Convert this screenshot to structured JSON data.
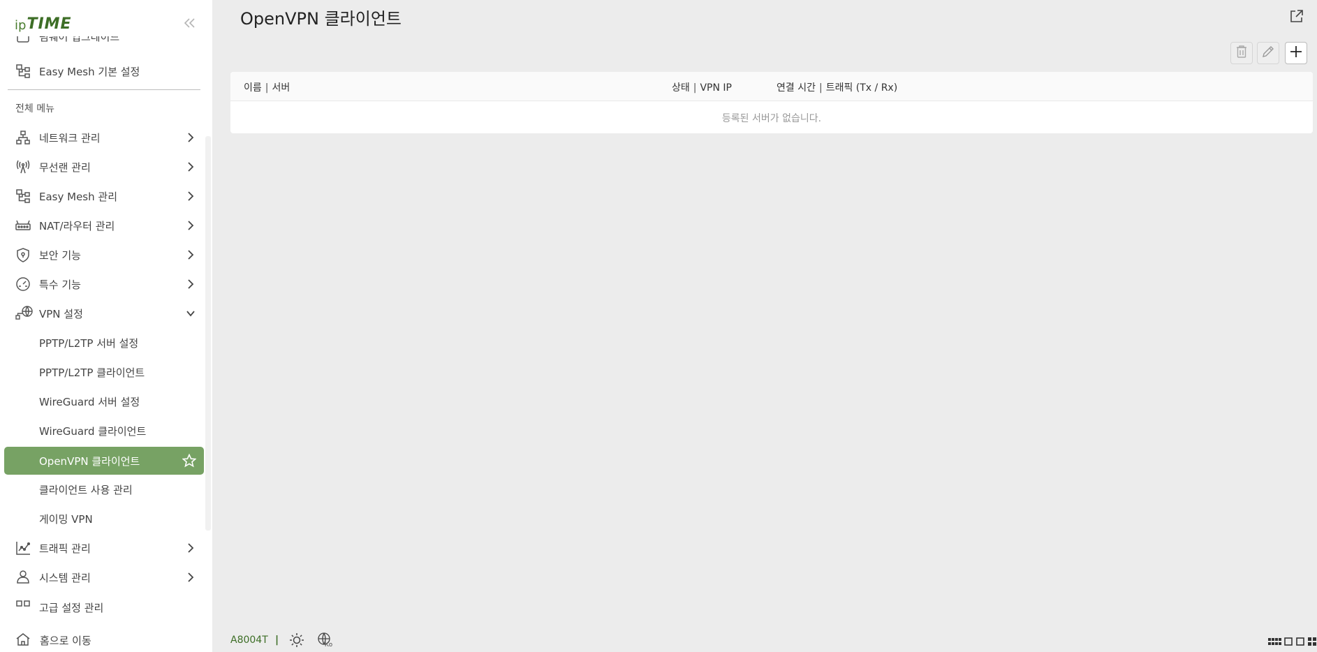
{
  "logo": {
    "ip": "ip",
    "time": "TIME"
  },
  "sidebar": {
    "partial_top_label": "펌웨어 업그레이드",
    "easymesh_basic": "Easy Mesh 기본 설정",
    "section_title": "전체 메뉴",
    "items": [
      {
        "label": "네트워크 관리",
        "icon": "network-icon"
      },
      {
        "label": "무선랜 관리",
        "icon": "wireless-icon"
      },
      {
        "label": "Easy Mesh 관리",
        "icon": "mesh-icon"
      },
      {
        "label": "NAT/라우터 관리",
        "icon": "router-icon"
      },
      {
        "label": "보안 기능",
        "icon": "shield-icon"
      },
      {
        "label": "특수 기능",
        "icon": "gauge-icon"
      },
      {
        "label": "VPN 설정",
        "icon": "vpn-globe-icon"
      }
    ],
    "vpn_sub": [
      {
        "label": "PPTP/L2TP 서버 설정"
      },
      {
        "label": "PPTP/L2TP 클라이언트"
      },
      {
        "label": "WireGuard 서버 설정"
      },
      {
        "label": "WireGuard 클라이언트"
      },
      {
        "label": "OpenVPN 클라이언트"
      },
      {
        "label": "클라이언트 사용 관리"
      },
      {
        "label": "게이밍 VPN"
      }
    ],
    "items_after": [
      {
        "label": "트래픽 관리",
        "icon": "traffic-chart-icon"
      },
      {
        "label": "시스템 관리",
        "icon": "system-user-icon"
      }
    ],
    "partial_bottom_label": "고급 설정 관리",
    "home": "홈으로 이동"
  },
  "page": {
    "title": "OpenVPN 클라이언트"
  },
  "table": {
    "col_name": "이름",
    "col_server": "서버",
    "col_status": "상태",
    "col_vpn_ip": "VPN IP",
    "col_conn_time": "연결 시간",
    "col_traffic": "트래픽 (Tx / Rx)",
    "empty_message": "등록된 서버가 없습니다."
  },
  "footer": {
    "model": "A8004T",
    "separator": "|",
    "lang_short": "Ko"
  },
  "colors": {
    "accent": "#77a264",
    "brand": "#3d6e26",
    "background": "#ececec"
  }
}
